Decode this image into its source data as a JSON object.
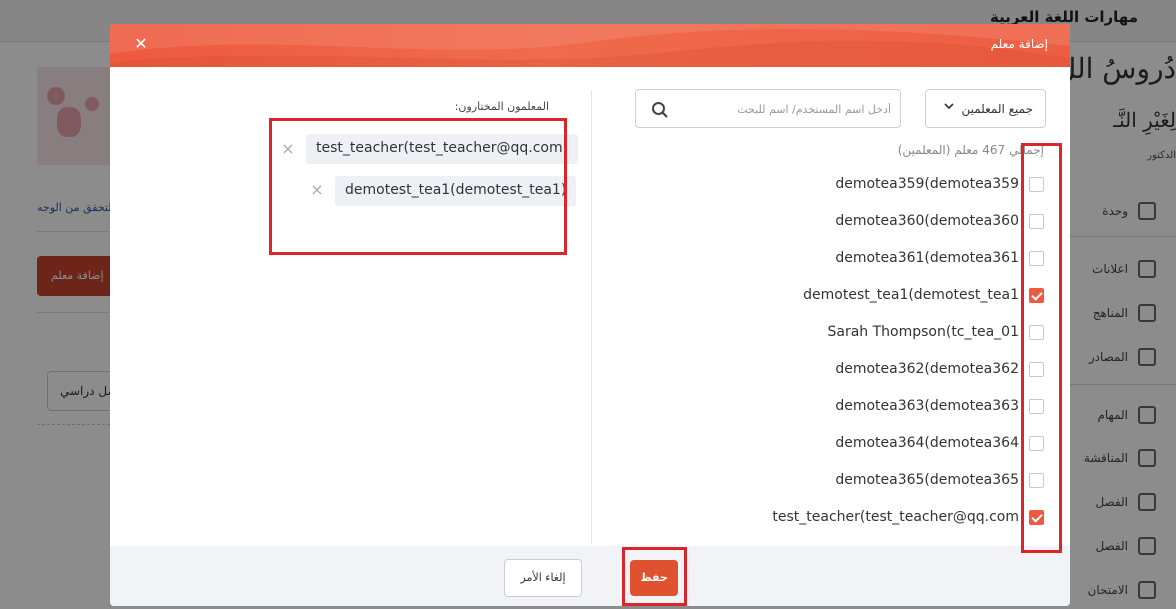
{
  "background": {
    "app_title": "مهارات اللغة العربية",
    "logo_line1": "دُروسُ اللُّ",
    "logo_line2": "لِغَيْرِ النَّـ",
    "logo_small": "الدكتور",
    "nav_items": [
      "وحدة",
      "اعلانات",
      "المناهج",
      "المصادر",
      "المهام",
      "المناقشة",
      "الفصل",
      "الفصل",
      "الامتحان"
    ],
    "face_verify_link": "التحقق من الوجه",
    "add_teacher_button": "إضافة معلم",
    "class_select": "فصل دراسي"
  },
  "modal": {
    "title": "إضافة معلم",
    "close_icon": "close-icon",
    "filter": {
      "selected": "جميع المعلمين",
      "icon": "chevron-down-icon"
    },
    "search": {
      "placeholder": "أدخل اسم المستخدم/ اسم للبحث",
      "value": ""
    },
    "total_text": "إجمالي 467 معلم (المعلمين)",
    "teachers": [
      {
        "name": "demotea359(demotea359",
        "checked": false
      },
      {
        "name": "demotea360(demotea360",
        "checked": false
      },
      {
        "name": "demotea361(demotea361",
        "checked": false
      },
      {
        "name": "demotest_tea1(demotest_tea1",
        "checked": true
      },
      {
        "name": "Sarah Thompson(tc_tea_01",
        "checked": false
      },
      {
        "name": "demotea362(demotea362",
        "checked": false
      },
      {
        "name": "demotea363(demotea363",
        "checked": false
      },
      {
        "name": "demotea364(demotea364",
        "checked": false
      },
      {
        "name": "demotea365(demotea365",
        "checked": false
      },
      {
        "name": "test_teacher(test_teacher@qq.com",
        "checked": true
      }
    ],
    "selected_label": "المعلمون المختارون:",
    "selected_teachers": [
      "test_teacher(test_teacher@qq.com)",
      "demotest_tea1(demotest_tea1)"
    ],
    "cancel_label": "إلغاء الأمر",
    "save_label": "حفظ",
    "accent_color": "#ee5a3f",
    "annotation_color": "#d9262a"
  }
}
